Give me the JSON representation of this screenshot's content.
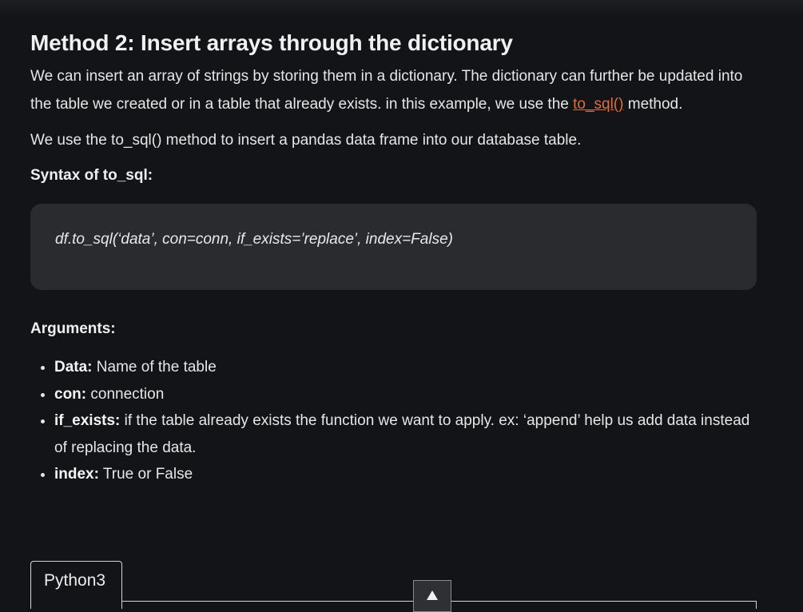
{
  "article": {
    "heading": "Method 2: Insert arrays through the dictionary",
    "intro": "We can insert an array of strings by storing them in a dictionary. The dictionary can further be updated into the table we created or in a table that already exists. in this example, we use the ",
    "intro_link": "to_sql()",
    "intro_end": " method.",
    "para2": "We use the to_sql() method to insert a pandas data frame into our database table.",
    "syntax_heading": "Syntax of to_sql:",
    "code": "df.to_sql(‘data’, con=conn, if_exists=’replace’, index=False)",
    "args_heading": "Arguments:",
    "args": [
      {
        "term": "Data:",
        "desc": " Name of the table"
      },
      {
        "term": "con:",
        "desc": " connection"
      },
      {
        "term": "if_exists:",
        "desc": " if the table already exists the function we want to apply. ex: ‘append’ help us add data instead of replacing the data."
      },
      {
        "term": "index:",
        "desc": " True or False"
      }
    ]
  },
  "code_tabs": {
    "active_tab": "Python3"
  },
  "icons": {
    "scroll_top": "arrow-up-icon"
  },
  "colors": {
    "background": "#131417",
    "link": "#e06c3c",
    "code_bg": "#2a2b2e"
  }
}
